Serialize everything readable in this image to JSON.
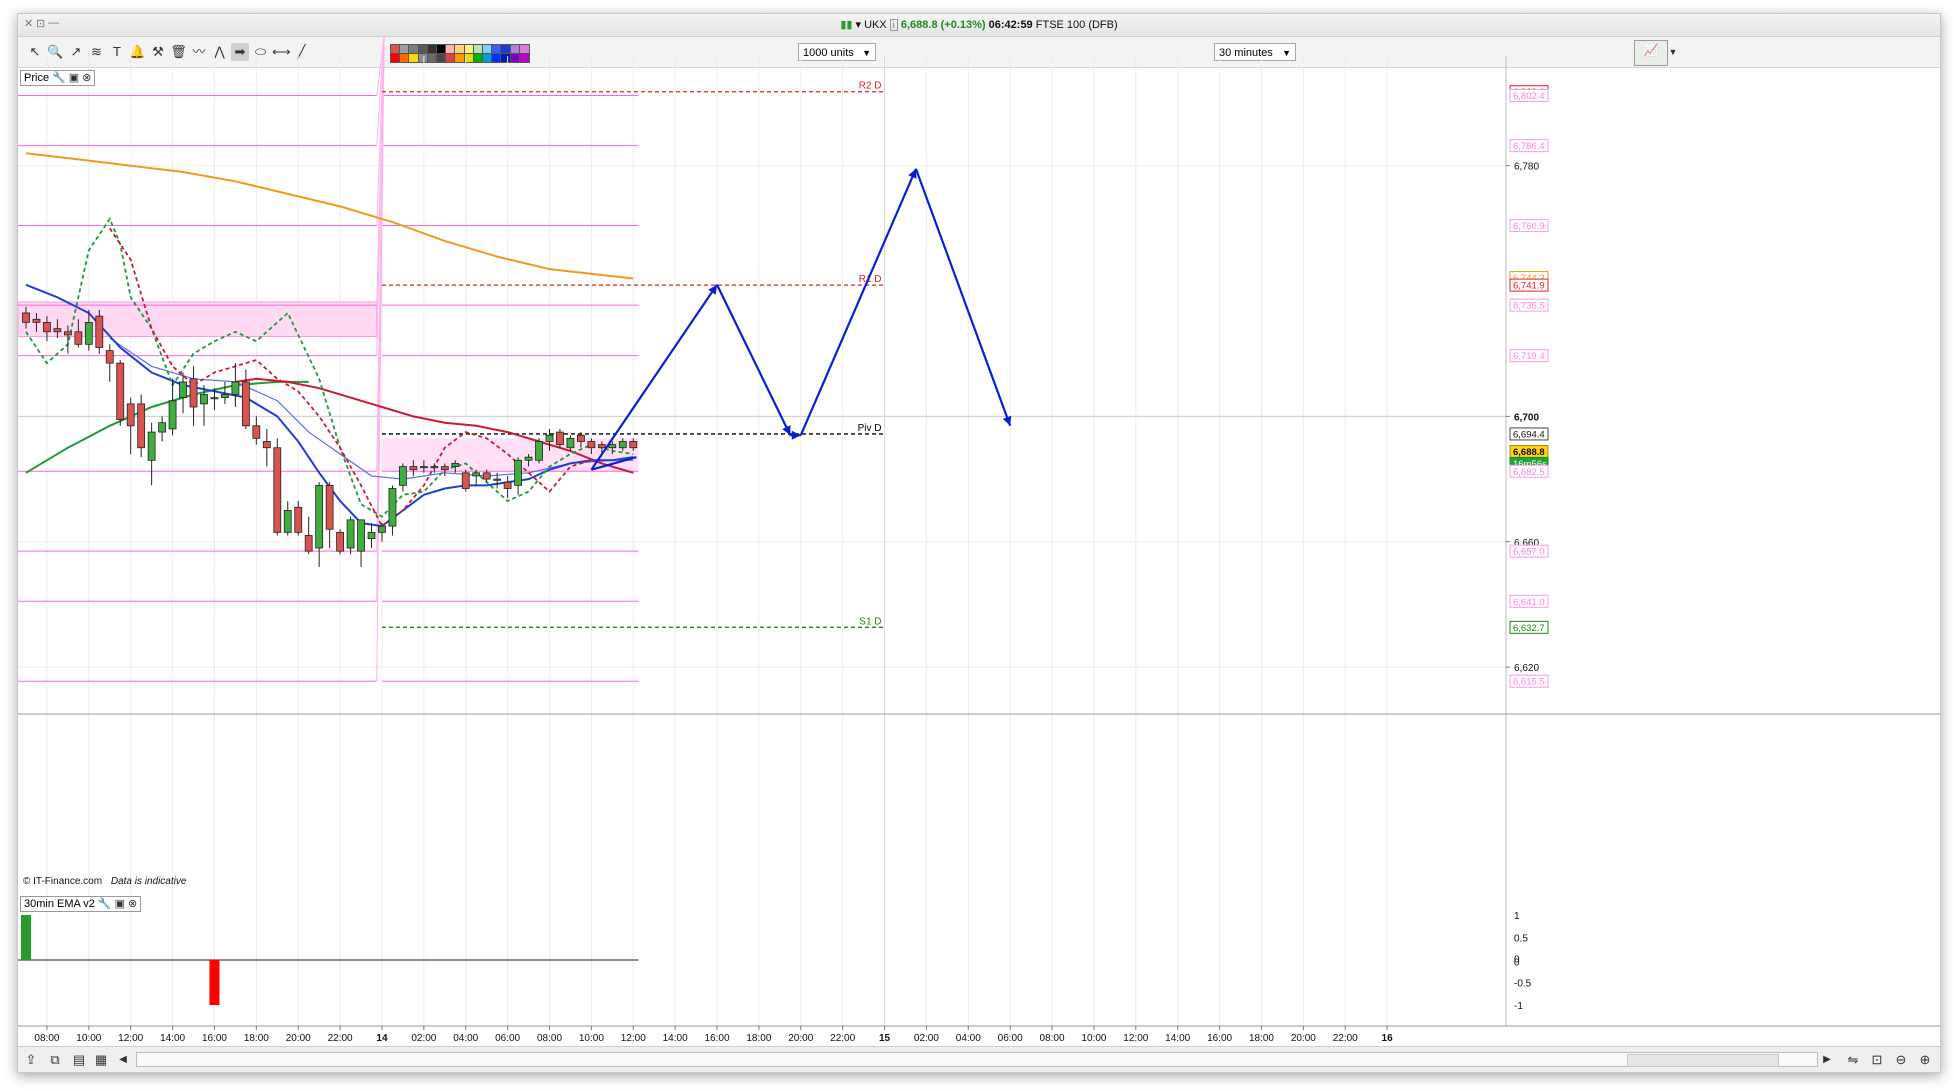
{
  "window": {
    "controls": [
      "✕",
      "⊡",
      "—"
    ],
    "title_symbol": "UKX",
    "title_price": "6,688.8",
    "title_change": "(+0.13%)",
    "title_time": "06:42:59",
    "title_name": "FTSE 100 (DFB)"
  },
  "toolbar": {
    "tools": [
      {
        "name": "pointer-icon",
        "glyph": "↖"
      },
      {
        "name": "zoom-icon",
        "glyph": "🔍"
      },
      {
        "name": "trend-tool-icon",
        "glyph": "↗"
      },
      {
        "name": "fibonacci-icon",
        "glyph": "≋"
      },
      {
        "name": "text-tool-icon",
        "glyph": "T"
      },
      {
        "name": "alert-bell-icon",
        "glyph": "🔔"
      },
      {
        "name": "settings-tools-icon",
        "glyph": "⚒"
      },
      {
        "name": "trash-icon",
        "glyph": "🗑"
      },
      {
        "name": "wave-tool-icon",
        "glyph": "〰"
      },
      {
        "name": "zigzag-tool-icon",
        "glyph": "⋀"
      },
      {
        "name": "arrow-tool-icon",
        "glyph": "➡"
      },
      {
        "name": "ellipse-tool-icon",
        "glyph": "⬭"
      },
      {
        "name": "horizontal-line-icon",
        "glyph": "⟷"
      },
      {
        "name": "diagonal-line-icon",
        "glyph": "╱"
      }
    ],
    "palette_top": [
      "#d9534f",
      "#9e9e9e",
      "#7d7d7d",
      "#5a5a5a",
      "#333333",
      "#000000",
      "#ffb3b3",
      "#ffd27f",
      "#fff27f",
      "#b3e6b3",
      "#7fd4ff",
      "#3a5cff",
      "#1a3bd9",
      "#b37fd9",
      "#d97fd9"
    ],
    "palette_bottom": [
      "#ff0000",
      "#ff6a00",
      "#ffd800",
      "#8a8a8a",
      "#6a6a6a",
      "#4a4a4a",
      "#e04040",
      "#ff9a00",
      "#e0e000",
      "#00b000",
      "#00a0e0",
      "#0030ff",
      "#0018b0",
      "#8000c0",
      "#c000c0"
    ],
    "units_select": "1000 units",
    "interval_select": "30 minutes"
  },
  "panels": {
    "price_label": "Price",
    "indicator_label": "30min EMA v2",
    "copyright": "© IT-Finance.com",
    "indicative": "Data is indicative"
  },
  "colors": {
    "up": "#3fae3f",
    "down": "#d9534f",
    "ema_blue": "#1f3fd6",
    "ema_red": "#cc1a35",
    "ema_green": "#1d9a3a",
    "ema_orange": "#f29a1e",
    "pivot_pink": "#ff66d9",
    "projection": "#0a1fd0"
  },
  "chart_data": {
    "type": "candlestick",
    "symbol": "UKX",
    "ylim": [
      6606,
      6815
    ],
    "y_ticks": [
      6620,
      6660,
      6700,
      6780
    ],
    "x_axis_labels": [
      "04:00",
      "06:00",
      "08:00",
      "10:00",
      "12:00",
      "14:00",
      "16:00",
      "18:00",
      "20:00",
      "22:00",
      "14",
      "02:00",
      "04:00",
      "06:00",
      "08:00",
      "10:00",
      "12:00",
      "14:00",
      "16:00",
      "18:00",
      "20:00",
      "22:00",
      "15",
      "02:00",
      "04:00",
      "06:00",
      "08:00",
      "10:00",
      "12:00",
      "14:00",
      "16:00",
      "18:00",
      "20:00",
      "22:00",
      "16"
    ],
    "candles": [
      {
        "o": 6733,
        "h": 6735,
        "l": 6728,
        "c": 6730
      },
      {
        "o": 6731,
        "h": 6733,
        "l": 6727,
        "c": 6730
      },
      {
        "o": 6730,
        "h": 6732,
        "l": 6724,
        "c": 6727
      },
      {
        "o": 6728,
        "h": 6731,
        "l": 6725,
        "c": 6727
      },
      {
        "o": 6727,
        "h": 6729,
        "l": 6720,
        "c": 6726
      },
      {
        "o": 6727,
        "h": 6731,
        "l": 6722,
        "c": 6723
      },
      {
        "o": 6723,
        "h": 6734,
        "l": 6721,
        "c": 6730
      },
      {
        "o": 6732,
        "h": 6734,
        "l": 6720,
        "c": 6722
      },
      {
        "o": 6721,
        "h": 6723,
        "l": 6711,
        "c": 6717
      },
      {
        "o": 6717,
        "h": 6718,
        "l": 6697,
        "c": 6699
      },
      {
        "o": 6704,
        "h": 6706,
        "l": 6688,
        "c": 6697
      },
      {
        "o": 6704,
        "h": 6707,
        "l": 6687,
        "c": 6690
      },
      {
        "o": 6686,
        "h": 6698,
        "l": 6678,
        "c": 6695
      },
      {
        "o": 6695,
        "h": 6700,
        "l": 6692,
        "c": 6698
      },
      {
        "o": 6696,
        "h": 6712,
        "l": 6694,
        "c": 6705
      },
      {
        "o": 6706,
        "h": 6714,
        "l": 6701,
        "c": 6711
      },
      {
        "o": 6712,
        "h": 6716,
        "l": 6697,
        "c": 6703
      },
      {
        "o": 6704,
        "h": 6710,
        "l": 6697,
        "c": 6707
      },
      {
        "o": 6706,
        "h": 6709,
        "l": 6702,
        "c": 6706
      },
      {
        "o": 6706,
        "h": 6711,
        "l": 6704,
        "c": 6707
      },
      {
        "o": 6707,
        "h": 6717,
        "l": 6703,
        "c": 6711
      },
      {
        "o": 6711,
        "h": 6715,
        "l": 6696,
        "c": 6697
      },
      {
        "o": 6697,
        "h": 6700,
        "l": 6691,
        "c": 6693
      },
      {
        "o": 6692,
        "h": 6696,
        "l": 6684,
        "c": 6690
      },
      {
        "o": 6690,
        "h": 6693,
        "l": 6662,
        "c": 6663
      },
      {
        "o": 6663,
        "h": 6673,
        "l": 6662,
        "c": 6670
      },
      {
        "o": 6671,
        "h": 6673,
        "l": 6662,
        "c": 6663
      },
      {
        "o": 6662,
        "h": 6668,
        "l": 6656,
        "c": 6657
      },
      {
        "o": 6658,
        "h": 6679,
        "l": 6652,
        "c": 6678
      },
      {
        "o": 6678,
        "h": 6679,
        "l": 6658,
        "c": 6664
      },
      {
        "o": 6663,
        "h": 6664,
        "l": 6656,
        "c": 6657
      },
      {
        "o": 6658,
        "h": 6668,
        "l": 6656,
        "c": 6667
      },
      {
        "o": 6657,
        "h": 6667,
        "l": 6652,
        "c": 6667
      },
      {
        "o": 6661,
        "h": 6666,
        "l": 6658,
        "c": 6663
      },
      {
        "o": 6663,
        "h": 6666,
        "l": 6660,
        "c": 6665
      },
      {
        "o": 6665,
        "h": 6678,
        "l": 6662,
        "c": 6677
      },
      {
        "o": 6678,
        "h": 6685,
        "l": 6676,
        "c": 6684
      },
      {
        "o": 6684,
        "h": 6686,
        "l": 6681,
        "c": 6683
      },
      {
        "o": 6684,
        "h": 6686,
        "l": 6682,
        "c": 6684
      },
      {
        "o": 6684,
        "h": 6685,
        "l": 6682,
        "c": 6684
      },
      {
        "o": 6684,
        "h": 6685,
        "l": 6681,
        "c": 6683
      },
      {
        "o": 6684,
        "h": 6686,
        "l": 6682,
        "c": 6685
      },
      {
        "o": 6682,
        "h": 6683,
        "l": 6676,
        "c": 6677
      },
      {
        "o": 6681,
        "h": 6683,
        "l": 6678,
        "c": 6682
      },
      {
        "o": 6682,
        "h": 6683,
        "l": 6679,
        "c": 6680
      },
      {
        "o": 6680,
        "h": 6682,
        "l": 6677,
        "c": 6680
      },
      {
        "o": 6679,
        "h": 6681,
        "l": 6674,
        "c": 6677
      },
      {
        "o": 6678,
        "h": 6687,
        "l": 6675,
        "c": 6686
      },
      {
        "o": 6686,
        "h": 6688,
        "l": 6684,
        "c": 6687
      },
      {
        "o": 6686,
        "h": 6693,
        "l": 6685,
        "c": 6692
      },
      {
        "o": 6692,
        "h": 6696,
        "l": 6689,
        "c": 6694
      },
      {
        "o": 6695,
        "h": 6696,
        "l": 6690,
        "c": 6691
      },
      {
        "o": 6690,
        "h": 6694,
        "l": 6689,
        "c": 6693
      },
      {
        "o": 6694,
        "h": 6695,
        "l": 6690,
        "c": 6692
      },
      {
        "o": 6692,
        "h": 6693,
        "l": 6688,
        "c": 6690
      },
      {
        "o": 6691,
        "h": 6692,
        "l": 6688,
        "c": 6690
      },
      {
        "o": 6690,
        "h": 6692,
        "l": 6688,
        "c": 6691
      },
      {
        "o": 6690,
        "h": 6693,
        "l": 6689,
        "c": 6692
      },
      {
        "o": 6692,
        "h": 6693,
        "l": 6689,
        "c": 6690
      }
    ],
    "pivots": [
      {
        "label": "R2 D",
        "value": 6803.6,
        "color": "#e02020"
      },
      {
        "label": "R1 D",
        "value": 6741.9,
        "color": "#e02020"
      },
      {
        "label": "Piv D",
        "value": 6694.4,
        "color": "#000000"
      },
      {
        "label": "S1 D",
        "value": 6632.7,
        "color": "#1a8a1a"
      }
    ],
    "prev_day_levels": [
      6802.4,
      6786.4,
      6760.9,
      6735.5,
      6719.4,
      6682.5,
      6657.0,
      6641.0,
      6615.5
    ],
    "pink_zone_prev": [
      6725.5,
      6736.5
    ],
    "pink_zone_curr": [
      6682.5,
      6693
    ],
    "right_labels": [
      {
        "text": "6,803.6",
        "value": 6803.6,
        "style": "red"
      },
      {
        "text": "6,802.4",
        "value": 6802.4,
        "style": "pink"
      },
      {
        "text": "6,786.4",
        "value": 6786.4,
        "style": "pink"
      },
      {
        "text": "6,760.9",
        "value": 6760.9,
        "style": "pink"
      },
      {
        "text": "6,744.3",
        "value": 6744.3,
        "style": "orange"
      },
      {
        "text": "6,741.9",
        "value": 6741.9,
        "style": "red"
      },
      {
        "text": "6,735.5",
        "value": 6735.5,
        "style": "pink"
      },
      {
        "text": "6,719.4",
        "value": 6719.4,
        "style": "pink"
      },
      {
        "text": "6,694.4",
        "value": 6694.4,
        "style": "black"
      },
      {
        "text": "6,688.8",
        "value": 6688.8,
        "style": "current"
      },
      {
        "text": "16m56s",
        "value": 6685.0,
        "style": "timer"
      },
      {
        "text": "6,682.5",
        "value": 6682.5,
        "style": "pink"
      },
      {
        "text": "6,657.0",
        "value": 6657.0,
        "style": "pink"
      },
      {
        "text": "6,641.0",
        "value": 6641.0,
        "style": "pink"
      },
      {
        "text": "6,632.7",
        "value": 6632.7,
        "style": "green"
      },
      {
        "text": "6,615.5",
        "value": 6615.5,
        "style": "pink"
      }
    ],
    "ema_orange": [
      [
        0,
        6784
      ],
      [
        5,
        6782
      ],
      [
        10,
        6780
      ],
      [
        15,
        6778
      ],
      [
        20,
        6775
      ],
      [
        25,
        6771
      ],
      [
        30,
        6767
      ],
      [
        35,
        6762
      ],
      [
        40,
        6756
      ],
      [
        45,
        6751
      ],
      [
        50,
        6747
      ],
      [
        58,
        6744
      ]
    ],
    "ema_red": [
      [
        20,
        6711
      ],
      [
        22,
        6712
      ],
      [
        25,
        6711
      ],
      [
        28,
        6709
      ],
      [
        31,
        6706
      ],
      [
        34,
        6703
      ],
      [
        37,
        6700
      ],
      [
        40,
        6698
      ],
      [
        43,
        6697
      ],
      [
        46,
        6695
      ],
      [
        49,
        6692
      ],
      [
        52,
        6689
      ],
      [
        55,
        6685
      ],
      [
        58,
        6682
      ]
    ],
    "ema_green": [
      [
        0,
        6682
      ],
      [
        4,
        6690
      ],
      [
        8,
        6697
      ],
      [
        12,
        6703
      ],
      [
        16,
        6707
      ],
      [
        20,
        6710
      ],
      [
        24,
        6711
      ],
      [
        27,
        6711
      ]
    ],
    "ema_blue": [
      [
        0,
        6742
      ],
      [
        3,
        6738
      ],
      [
        6,
        6733
      ],
      [
        9,
        6722
      ],
      [
        12,
        6714
      ],
      [
        15,
        6710
      ],
      [
        18,
        6708
      ],
      [
        21,
        6706
      ],
      [
        24,
        6700
      ],
      [
        26,
        6692
      ],
      [
        28,
        6682
      ],
      [
        30,
        6673
      ],
      [
        32,
        6666
      ],
      [
        34,
        6665
      ],
      [
        36,
        6670
      ],
      [
        38,
        6675
      ],
      [
        40,
        6677
      ],
      [
        42,
        6678
      ],
      [
        44,
        6678
      ],
      [
        46,
        6679
      ],
      [
        48,
        6680
      ],
      [
        50,
        6683
      ],
      [
        52,
        6685
      ],
      [
        54,
        6686
      ],
      [
        56,
        6686
      ],
      [
        58,
        6687
      ]
    ],
    "ema_blue_thin": [
      [
        8,
        6725
      ],
      [
        12,
        6716
      ],
      [
        16,
        6712
      ],
      [
        20,
        6711
      ],
      [
        24,
        6705
      ],
      [
        27,
        6695
      ],
      [
        30,
        6688
      ],
      [
        33,
        6681
      ],
      [
        36,
        6680
      ],
      [
        40,
        6682
      ],
      [
        44,
        6681
      ],
      [
        48,
        6682
      ],
      [
        52,
        6685
      ],
      [
        56,
        6686
      ],
      [
        58,
        6686
      ]
    ],
    "dashed_green": [
      [
        0,
        6727
      ],
      [
        2,
        6717
      ],
      [
        4,
        6723
      ],
      [
        6,
        6753
      ],
      [
        8,
        6763
      ],
      [
        9,
        6755
      ],
      [
        10,
        6738
      ],
      [
        12,
        6728
      ],
      [
        14,
        6710
      ],
      [
        16,
        6720
      ],
      [
        18,
        6724
      ],
      [
        20,
        6727
      ],
      [
        22,
        6724
      ],
      [
        24,
        6730
      ],
      [
        25,
        6733
      ],
      [
        26,
        6726
      ],
      [
        28,
        6712
      ],
      [
        30,
        6690
      ],
      [
        32,
        6672
      ],
      [
        34,
        6668
      ],
      [
        36,
        6675
      ],
      [
        38,
        6676
      ],
      [
        40,
        6683
      ],
      [
        42,
        6685
      ],
      [
        44,
        6679
      ],
      [
        46,
        6673
      ],
      [
        48,
        6676
      ],
      [
        50,
        6684
      ],
      [
        52,
        6688
      ],
      [
        54,
        6691
      ],
      [
        56,
        6689
      ],
      [
        58,
        6688
      ]
    ],
    "dashed_red": [
      [
        8,
        6760
      ],
      [
        10,
        6750
      ],
      [
        12,
        6728
      ],
      [
        14,
        6716
      ],
      [
        16,
        6710
      ],
      [
        18,
        6714
      ],
      [
        20,
        6716
      ],
      [
        22,
        6718
      ],
      [
        24,
        6712
      ],
      [
        26,
        6708
      ],
      [
        28,
        6700
      ],
      [
        30,
        6690
      ],
      [
        32,
        6678
      ],
      [
        34,
        6665
      ],
      [
        36,
        6670
      ],
      [
        38,
        6678
      ],
      [
        40,
        6690
      ],
      [
        42,
        6695
      ],
      [
        44,
        6693
      ],
      [
        46,
        6688
      ],
      [
        48,
        6682
      ],
      [
        50,
        6676
      ],
      [
        52,
        6684
      ],
      [
        54,
        6686
      ],
      [
        56,
        6684
      ],
      [
        58,
        6682
      ]
    ],
    "projection": [
      {
        "t": "2024-06-14 06:30",
        "v": 6683
      },
      {
        "t": "2024-06-14 12:30",
        "v": 6742
      },
      {
        "t": "2024-06-14 16:00",
        "v": 6694
      },
      {
        "t": "2024-06-14 16:30",
        "v": 6694
      },
      {
        "t": "2024-06-14 22:00",
        "v": 6779
      },
      {
        "t": "2024-06-15 02:30",
        "v": 6697
      }
    ],
    "indicator": {
      "ylim": [
        -1.2,
        1.2
      ],
      "y_ticks": [
        "1",
        "0.5",
        "0",
        "0",
        "-0.5",
        "-1"
      ],
      "bars": [
        {
          "index": 0,
          "value": 1,
          "color": "#2a9a2a"
        },
        {
          "index": 18,
          "value": -1,
          "color": "#ff0000"
        }
      ]
    }
  }
}
